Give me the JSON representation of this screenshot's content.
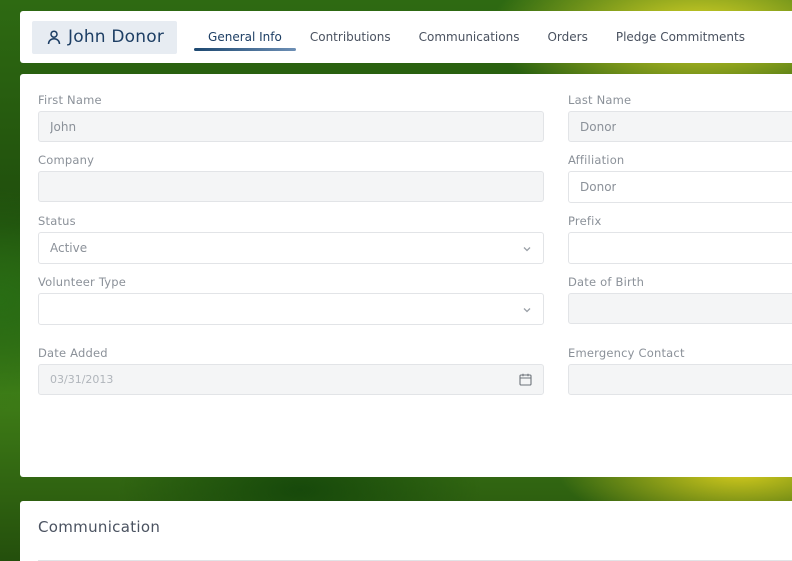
{
  "record": {
    "name": "John Donor",
    "icon": "person-icon"
  },
  "tabs": [
    {
      "label": "General Info",
      "active": true
    },
    {
      "label": "Contributions",
      "active": false
    },
    {
      "label": "Communications",
      "active": false
    },
    {
      "label": "Orders",
      "active": false
    },
    {
      "label": "Pledge Commitments",
      "active": false
    }
  ],
  "form": {
    "first_name": {
      "label": "First Name",
      "value": "John"
    },
    "last_name": {
      "label": "Last Name",
      "value": "Donor"
    },
    "company": {
      "label": "Company",
      "value": ""
    },
    "affiliation": {
      "label": "Affiliation",
      "value": "Donor"
    },
    "status": {
      "label": "Status",
      "value": "Active"
    },
    "prefix": {
      "label": "Prefix",
      "value": ""
    },
    "volunteer_type": {
      "label": "Volunteer Type",
      "value": ""
    },
    "date_of_birth": {
      "label": "Date of Birth",
      "value": ""
    },
    "date_added": {
      "label": "Date Added",
      "value": "03/31/2013"
    },
    "emergency_contact": {
      "label": "Emergency Contact",
      "value": ""
    }
  },
  "communication": {
    "title": "Communication"
  },
  "colors": {
    "accent": "#1d3e64",
    "card_bg": "#ffffff",
    "input_bg": "#f4f5f6",
    "label": "#8b9199"
  }
}
